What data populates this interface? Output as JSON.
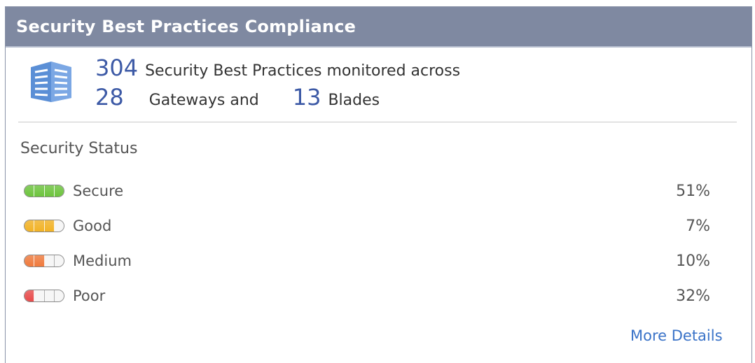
{
  "header": {
    "title": "Security Best Practices Compliance"
  },
  "summary": {
    "icon": "server-rack-icon",
    "practices_count": "304",
    "practices_text": "Security Best Practices monitored across",
    "gateways_count": "28",
    "gateways_text": "Gateways and",
    "blades_count": "13",
    "blades_text": "Blades"
  },
  "status": {
    "title": "Security Status",
    "items": [
      {
        "label": "Secure",
        "percent": "51%",
        "color": "#6cc43c",
        "filled_segments": 4,
        "total_segments": 4
      },
      {
        "label": "Good",
        "percent": "7%",
        "color": "#f2b224",
        "filled_segments": 3,
        "total_segments": 4
      },
      {
        "label": "Medium",
        "percent": "10%",
        "color": "#f07a3c",
        "filled_segments": 2,
        "total_segments": 4
      },
      {
        "label": "Poor",
        "percent": "32%",
        "color": "#e84a4a",
        "filled_segments": 1,
        "total_segments": 4
      }
    ]
  },
  "footer": {
    "more_details": "More Details"
  },
  "colors": {
    "header_bg": "#7f89a1",
    "accent": "#3d5aa6",
    "link": "#3a73c8"
  }
}
